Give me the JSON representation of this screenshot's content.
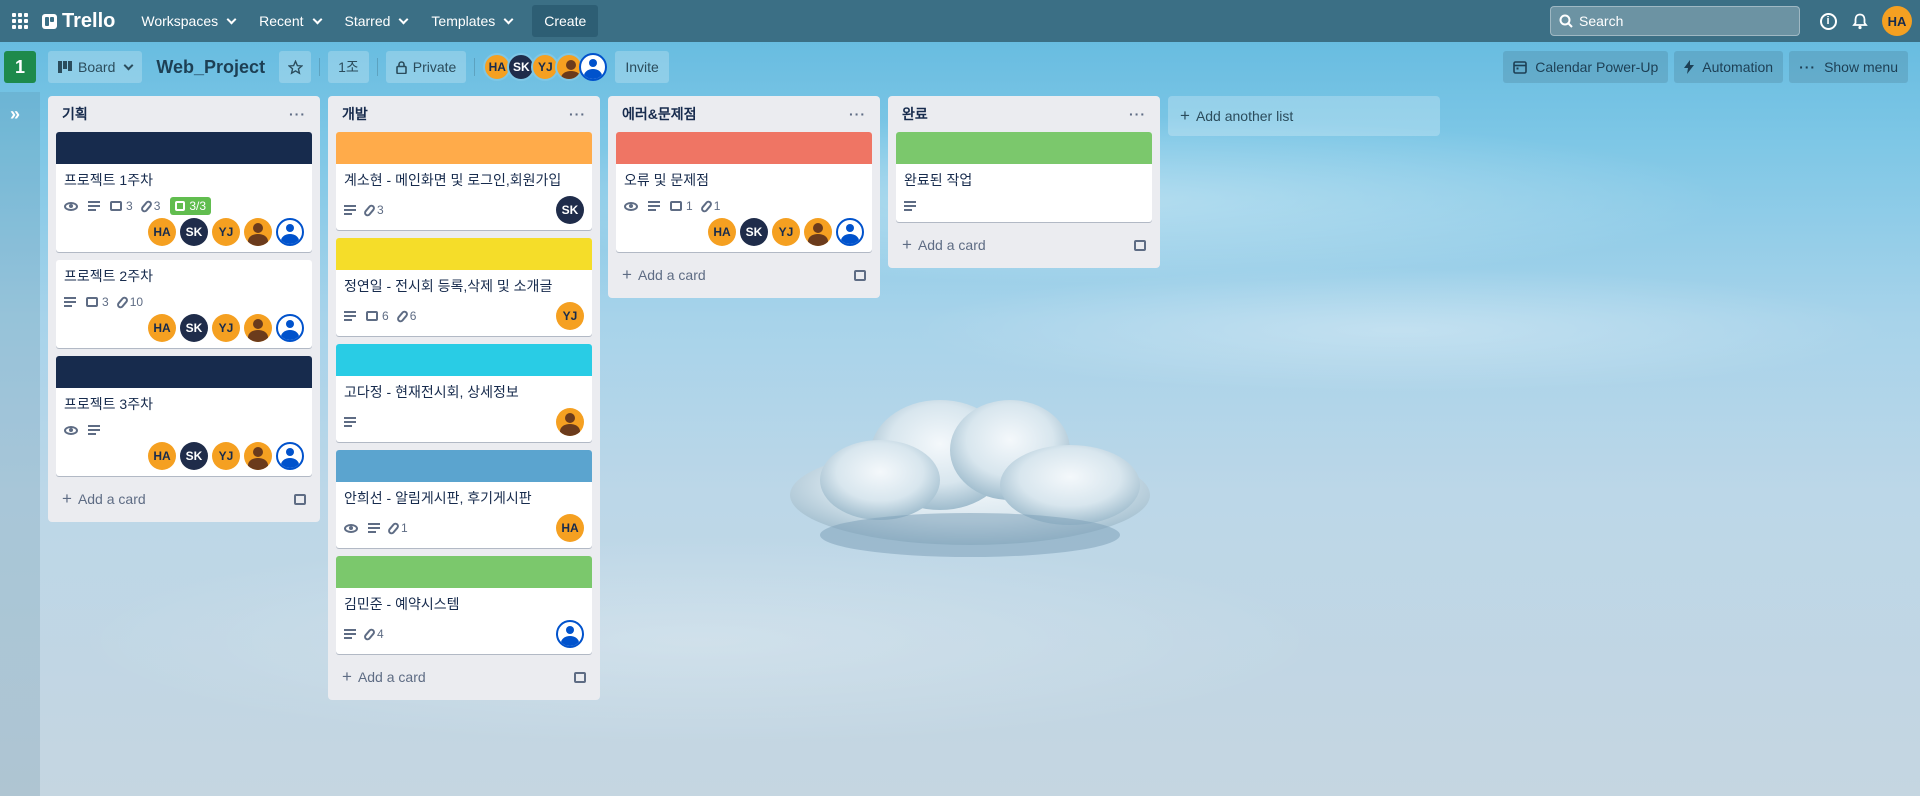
{
  "topbar": {
    "logo": "Trello",
    "nav": [
      "Workspaces",
      "Recent",
      "Starred",
      "Templates"
    ],
    "create": "Create",
    "search_placeholder": "Search",
    "user_initials": "HA"
  },
  "board": {
    "badge": "1",
    "view": "Board",
    "name": "Web_Project",
    "team": "1조",
    "visibility": "Private",
    "members": [
      {
        "initials": "HA",
        "style": "o"
      },
      {
        "initials": "SK",
        "style": "n"
      },
      {
        "initials": "YJ",
        "style": "o"
      },
      {
        "initials": "",
        "style": "p"
      },
      {
        "initials": "",
        "style": "b"
      }
    ],
    "invite": "Invite",
    "right_buttons": [
      "Calendar Power-Up",
      "Automation",
      "Show menu"
    ]
  },
  "lists": [
    {
      "title": "기획",
      "add_card": "Add a card",
      "cards": [
        {
          "cover": "#172b4d",
          "title": "프로젝트 1주차",
          "watch": true,
          "desc": true,
          "comments": "3",
          "attachments": "3",
          "checklist": "3/3",
          "members": [
            "HA",
            "SK",
            "YJ",
            "p",
            "b"
          ]
        },
        {
          "cover": "",
          "title": "프로젝트 2주차",
          "watch": false,
          "desc": true,
          "comments": "3",
          "attachments": "10",
          "checklist": "",
          "members": [
            "HA",
            "SK",
            "YJ",
            "p",
            "b"
          ]
        },
        {
          "cover": "#172b4d",
          "title": "프로젝트 3주차",
          "watch": true,
          "desc": true,
          "comments": "",
          "attachments": "",
          "checklist": "",
          "members": [
            "HA",
            "SK",
            "YJ",
            "p",
            "b"
          ]
        }
      ]
    },
    {
      "title": "개발",
      "add_card": "Add a card",
      "cards": [
        {
          "cover": "#ffab4a",
          "title": "계소현 - 메인화면 및 로그인,회원가입",
          "watch": false,
          "desc": true,
          "comments": "",
          "attachments": "3",
          "checklist": "",
          "members": [
            "SK"
          ]
        },
        {
          "cover": "#f5dd29",
          "title": "정연일 - 전시회 등록,삭제 및 소개글",
          "watch": false,
          "desc": true,
          "comments": "6",
          "attachments": "6",
          "checklist": "",
          "members": [
            "YJ"
          ]
        },
        {
          "cover": "#29cce5",
          "title": "고다정 - 현재전시회, 상세정보",
          "watch": false,
          "desc": true,
          "comments": "",
          "attachments": "",
          "checklist": "",
          "members": [
            "p"
          ]
        },
        {
          "cover": "#5ba4cf",
          "title": "안희선 - 알림게시판, 후기게시판",
          "watch": true,
          "desc": true,
          "comments": "",
          "attachments": "1",
          "checklist": "",
          "members": [
            "HA"
          ]
        },
        {
          "cover": "#7bc86c",
          "title": "김민준 - 예약시스템",
          "watch": false,
          "desc": true,
          "comments": "",
          "attachments": "4",
          "checklist": "",
          "members": [
            "b"
          ]
        }
      ]
    },
    {
      "title": "에러&문제점",
      "add_card": "Add a card",
      "cards": [
        {
          "cover": "#ef7564",
          "title": "오류 및 문제점",
          "watch": true,
          "desc": true,
          "comments": "1",
          "attachments": "1",
          "checklist": "",
          "members": [
            "HA",
            "SK",
            "YJ",
            "p",
            "b"
          ]
        }
      ]
    },
    {
      "title": "완료",
      "add_card": "Add a card",
      "cards": [
        {
          "cover": "#7bc86c",
          "title": "완료된 작업",
          "watch": false,
          "desc": true,
          "comments": "",
          "attachments": "",
          "checklist": "",
          "members": []
        }
      ]
    }
  ],
  "add_list": "Add another list"
}
